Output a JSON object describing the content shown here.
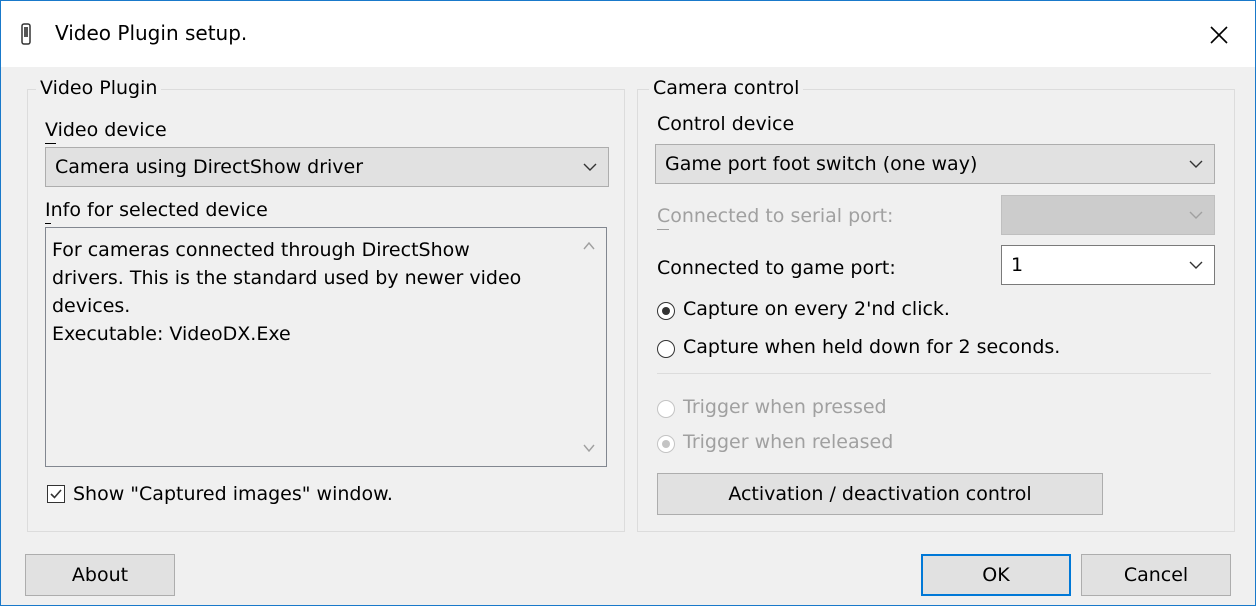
{
  "window": {
    "title": "Video Plugin setup."
  },
  "video_plugin": {
    "group_label": "Video Plugin",
    "video_device_label": "Video device",
    "video_device_value": "Camera using DirectShow driver",
    "info_label": "Info for selected device",
    "info_lines": [
      "For cameras connected through DirectShow",
      "drivers. This is the standard used by newer video",
      "devices.",
      "Executable: VideoDX.Exe"
    ],
    "show_captured_label": "Show \"Captured images\" window.",
    "show_captured_checked": true
  },
  "camera_control": {
    "group_label": "Camera control",
    "control_device_label": "Control device",
    "control_device_value": "Game port foot switch (one way)",
    "serial_port_label": "Connected to serial port:",
    "serial_port_value": "",
    "game_port_label": "Connected to game port:",
    "game_port_value": "1",
    "capture_every_label": "Capture on every 2'nd click.",
    "capture_held_label": "Capture when held down for 2 seconds.",
    "capture_selected": "every",
    "trigger_pressed_label": "Trigger when pressed",
    "trigger_released_label": "Trigger when released",
    "trigger_selected": "released",
    "activation_button_label": "Activation / deactivation control"
  },
  "footer": {
    "about_label": "About",
    "ok_label": "OK",
    "cancel_label": "Cancel"
  }
}
